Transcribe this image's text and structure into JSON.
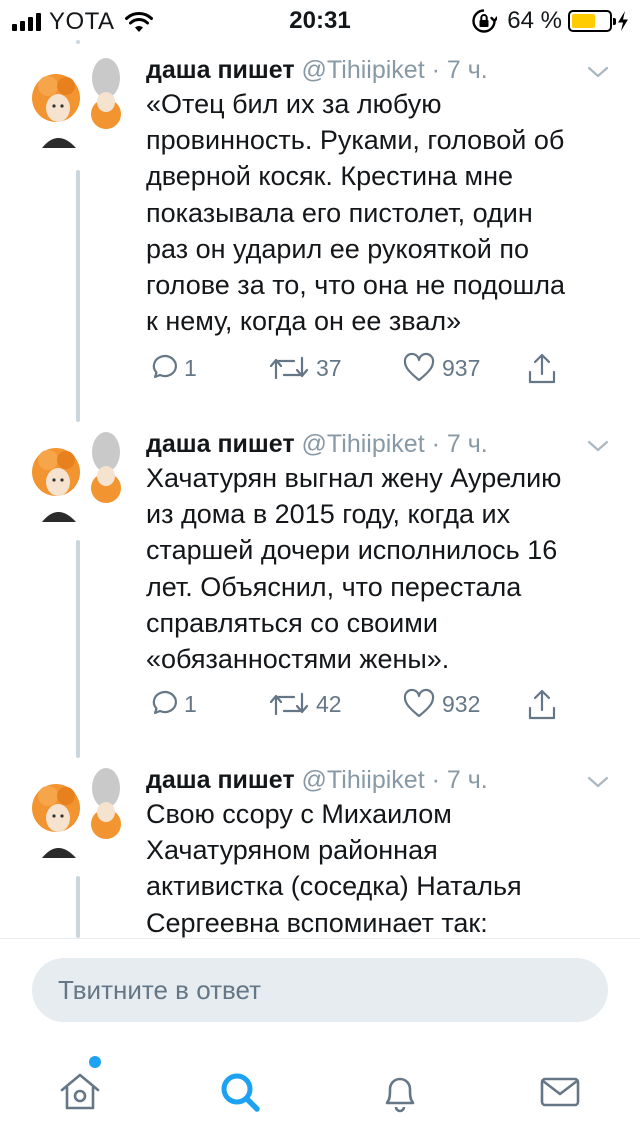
{
  "status_bar": {
    "carrier": "YOTA",
    "time": "20:31",
    "battery_percent": "64 %",
    "battery_level": 0.64,
    "battery_color": "#ffcc00"
  },
  "tweets": [
    {
      "name": "даша пишет",
      "handle": "@Tihiipiket",
      "separator": "·",
      "time": "7 ч.",
      "lines": [
        "«Отец бил их за любую",
        "провинность. Руками, головой об",
        "дверной косяк. Крестина мне",
        "показывала его пистолет, один",
        "раз он ударил ее рукояткой по",
        "голове за то, что она не подошла",
        "к нему, когда он ее звал»"
      ],
      "replies": "1",
      "retweets": "37",
      "likes": "937"
    },
    {
      "name": "даша пишет",
      "handle": "@Tihiipiket",
      "separator": "·",
      "time": "7 ч.",
      "lines": [
        "Хачатурян выгнал жену Аурелию",
        "из дома в 2015 году, когда их",
        "старшей дочери исполнилось 16",
        "лет. Объяснил, что перестала",
        "справляться со своими",
        "«обязанностями жены»."
      ],
      "replies": "1",
      "retweets": "42",
      "likes": "932"
    },
    {
      "name": "даша пишет",
      "handle": "@Tihiipiket",
      "separator": "·",
      "time": "7 ч.",
      "lines": [
        "Свою ссору с Михаилом",
        "Хачатуряном районная",
        "активистка (соседка) Наталья",
        "Сергеевна вспоминает так:"
      ]
    }
  ],
  "reply": {
    "placeholder": "Твитните в ответ"
  },
  "tab_bar": {
    "items": [
      "home-icon",
      "search-icon",
      "notifications-icon",
      "messages-icon"
    ],
    "active": "search-icon",
    "accent": "#1da1f2",
    "icon_color": "#657786"
  }
}
